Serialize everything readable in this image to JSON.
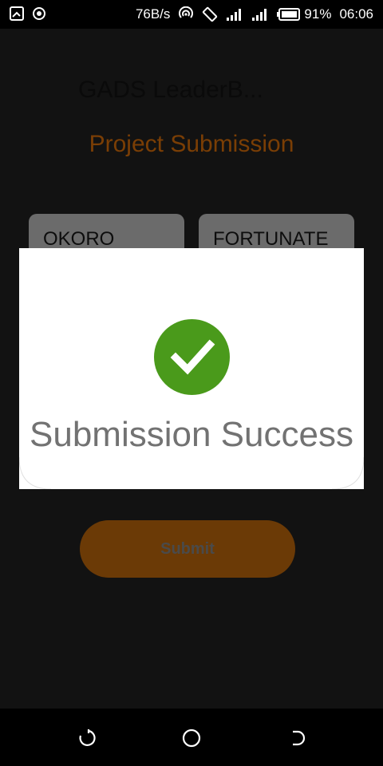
{
  "status_bar": {
    "speed": "76B/s",
    "battery": "91%",
    "time": "06:06",
    "icons": [
      "screenshot-icon",
      "record-icon",
      "hotspot-icon",
      "rotate-icon",
      "signal-icon",
      "data-signal-icon",
      "battery-icon"
    ]
  },
  "app": {
    "title": "GADS LeaderB...",
    "heading": "Project Submission",
    "first_name": "OKORO",
    "last_name": "FORTUNATE",
    "submit_label": "Submit"
  },
  "dialog": {
    "message": "Submission Success",
    "icon": "check-circle-icon"
  },
  "nav_bar": {
    "icons": [
      "back-icon",
      "home-icon",
      "recents-icon"
    ]
  },
  "colors": {
    "accent": "#7a3e05",
    "success": "#4a9a1b",
    "overlay": "#121212"
  }
}
